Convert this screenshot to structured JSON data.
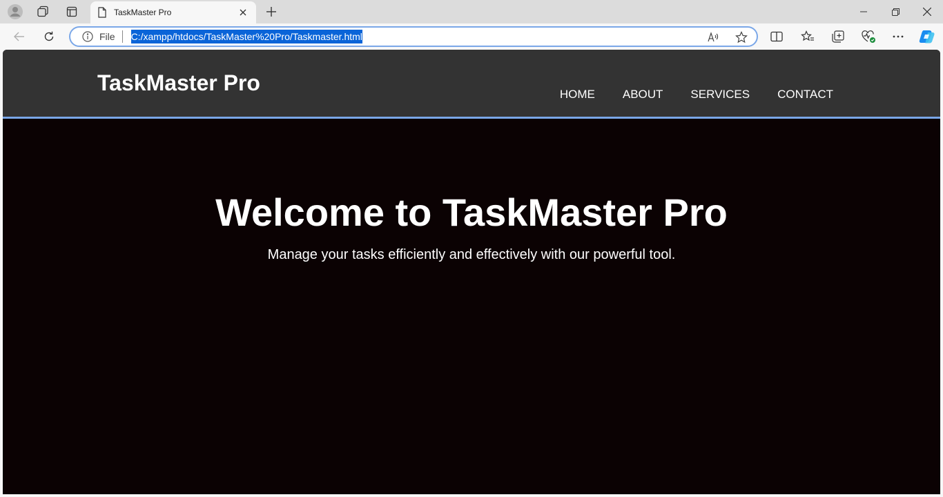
{
  "browser": {
    "tab": {
      "title": "TaskMaster Pro"
    },
    "address": {
      "scheme_label": "File",
      "url": "C:/xampp/htdocs/TaskMaster%20Pro/Taskmaster.html"
    },
    "icons": {
      "profile": "profile-icon",
      "workspaces": "workspaces-icon",
      "tab_actions": "tab-actions-icon",
      "page": "page-icon",
      "close_tab": "close-icon",
      "new_tab": "plus-icon",
      "minimize": "minimize-icon",
      "restore": "restore-icon",
      "close_window": "close-icon",
      "back": "back-arrow-icon",
      "refresh": "refresh-icon",
      "info": "info-icon",
      "read_aloud": "read-aloud-icon",
      "favorite": "star-icon",
      "split_screen": "split-screen-icon",
      "favorites": "favorites-icon",
      "collections": "collections-icon",
      "performance": "heart-pulse-icon",
      "more": "more-icon",
      "copilot": "copilot-icon"
    },
    "colors": {
      "url_highlight": "#0a64d8",
      "omnibox_border": "#7aa7e8"
    }
  },
  "site": {
    "logo": "TaskMaster Pro",
    "nav": [
      "HOME",
      "ABOUT",
      "SERVICES",
      "CONTACT"
    ],
    "hero": {
      "title": "Welcome to TaskMaster Pro",
      "subtitle": "Manage your tasks efficiently and effectively with our powerful tool."
    },
    "colors": {
      "header_bg": "#333333",
      "header_border": "#7aa7e8",
      "page_bg": "#0b0203",
      "text": "#ffffff"
    }
  }
}
